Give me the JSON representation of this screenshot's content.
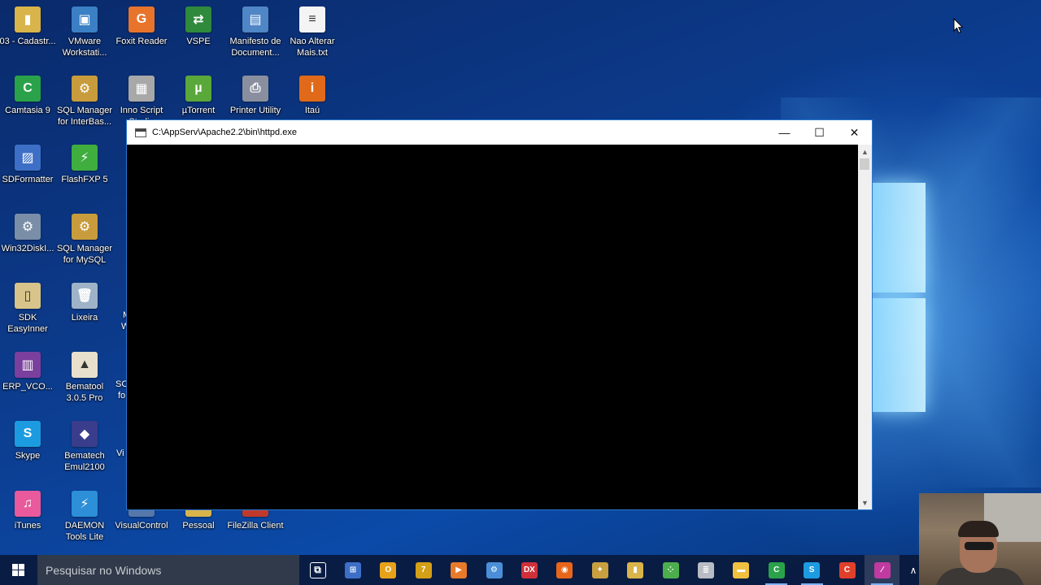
{
  "desktop": {
    "icons": [
      {
        "label": "03 - Cadastr...",
        "icon": "folder-file-icon",
        "color": "#d9b44a",
        "glyph": "▮"
      },
      {
        "label": "VMware Workstati...",
        "icon": "vmware-icon",
        "color": "#3b7fc4",
        "glyph": "▣"
      },
      {
        "label": "Foxit Reader",
        "icon": "foxit-reader-icon",
        "color": "#e8742c",
        "glyph": "G"
      },
      {
        "label": "VSPE",
        "icon": "vspe-icon",
        "color": "#2f8a3c",
        "glyph": "⇄"
      },
      {
        "label": "Manifesto de Document...",
        "icon": "manifesto-icon",
        "color": "#4f86c6",
        "glyph": "▤"
      },
      {
        "label": "Nao Alterar Mais.txt",
        "icon": "text-file-icon",
        "color": "#f4f4f4",
        "glyph": "≡"
      },
      {
        "label": "Camtasia 9",
        "icon": "camtasia-icon",
        "color": "#2aa24a",
        "glyph": "C"
      },
      {
        "label": "SQL Manager for InterBas...",
        "icon": "sql-manager-interbase-icon",
        "color": "#c89b3c",
        "glyph": "⚙"
      },
      {
        "label": "Inno Script Studio",
        "icon": "inno-script-icon",
        "color": "#a8a8a8",
        "glyph": "▦"
      },
      {
        "label": "µTorrent",
        "icon": "utorrent-icon",
        "color": "#5aa83a",
        "glyph": "µ"
      },
      {
        "label": "Printer Utility",
        "icon": "printer-utility-icon",
        "color": "#8a8fa0",
        "glyph": "⎙"
      },
      {
        "label": "Itaú",
        "icon": "itau-icon",
        "color": "#e06a1a",
        "glyph": "i"
      },
      {
        "label": "SDFormatter",
        "icon": "sdformatter-icon",
        "color": "#3d6fc7",
        "glyph": "▨"
      },
      {
        "label": "FlashFXP 5",
        "icon": "flashfxp-icon",
        "color": "#3fae3f",
        "glyph": "⚡"
      },
      {
        "label": "Win32DiskI...",
        "icon": "win32diskimager-icon",
        "color": "#7a8ea8",
        "glyph": "⚙"
      },
      {
        "label": "SQL Manager for MySQL",
        "icon": "sql-manager-mysql-icon",
        "color": "#c89b3c",
        "glyph": "⚙"
      },
      {
        "label": "SDK EasyInner",
        "icon": "sdk-easyinner-icon",
        "color": "#d8c48a",
        "glyph": "▯"
      },
      {
        "label": "Lixeira",
        "icon": "recycle-bin-icon",
        "color": "#9fb3c8",
        "glyph": "🗑"
      },
      {
        "label": "ERP_VCO...",
        "icon": "erp-archive-icon",
        "color": "#7b3f9e",
        "glyph": "▥"
      },
      {
        "label": "Bematool 3.0.5 Pro",
        "icon": "bematool-icon",
        "color": "#e8e0cc",
        "glyph": "▲"
      },
      {
        "label": "Skype",
        "icon": "skype-icon",
        "color": "#1d9be0",
        "glyph": "S"
      },
      {
        "label": "Bematech Emul2100",
        "icon": "bematech-icon",
        "color": "#3a3d8c",
        "glyph": "◆"
      },
      {
        "label": "iTunes",
        "icon": "itunes-icon",
        "color": "#e85a9c",
        "glyph": "♫"
      },
      {
        "label": "DAEMON Tools Lite",
        "icon": "daemon-tools-icon",
        "color": "#2d8fd8",
        "glyph": "⚡"
      },
      {
        "label": "VisualControl",
        "icon": "visualcontrol-icon",
        "color": "#5577aa",
        "glyph": "▣"
      },
      {
        "label": "Pessoal",
        "icon": "pessoal-folder-icon",
        "color": "#d9b44a",
        "glyph": "▮"
      },
      {
        "label": "FileZilla Client",
        "icon": "filezilla-icon",
        "color": "#c0392b",
        "glyph": "Z"
      }
    ],
    "partial_labels": [
      "M",
      "W",
      "SC",
      "fo",
      "Vi"
    ]
  },
  "console_window": {
    "title": "C:\\AppServ\\Apache2.2\\bin\\httpd.exe",
    "minimize_glyph": "—",
    "maximize_glyph": "☐",
    "close_glyph": "✕",
    "scroll_up_glyph": "▲",
    "scroll_down_glyph": "▼"
  },
  "taskbar": {
    "search_placeholder": "Pesquisar no Windows",
    "tray_chevron": "∧",
    "apps": [
      {
        "name": "task-view-icon",
        "glyph": "⧉",
        "color": "transparent"
      },
      {
        "name": "network-app-icon",
        "glyph": "⊞",
        "color": "#3d6fc7"
      },
      {
        "name": "outlook-icon",
        "glyph": "O",
        "color": "#e8a21a"
      },
      {
        "name": "seven-zip-icon",
        "glyph": "7",
        "color": "#d4a017"
      },
      {
        "name": "media-player-icon",
        "glyph": "▶",
        "color": "#e87a2a"
      },
      {
        "name": "settings-gear-icon",
        "glyph": "⚙",
        "color": "#4a8fd8"
      },
      {
        "name": "dx-icon",
        "glyph": "DX",
        "color": "#d0303a"
      },
      {
        "name": "firefox-icon",
        "glyph": "◉",
        "color": "#e8661a"
      },
      {
        "name": "explorer-tree-icon",
        "glyph": "✦",
        "color": "#c8a040"
      },
      {
        "name": "archive-app-icon",
        "glyph": "▮",
        "color": "#d9b44a"
      },
      {
        "name": "dots-app-icon",
        "glyph": "⁘",
        "color": "#4cae4c"
      },
      {
        "name": "database-icon",
        "glyph": "≣",
        "color": "#b8bcc4"
      },
      {
        "name": "file-explorer-icon",
        "glyph": "▬",
        "color": "#f0c040"
      },
      {
        "name": "camtasia-taskbar-icon",
        "glyph": "C",
        "color": "#2aa24a"
      },
      {
        "name": "skype-taskbar-icon",
        "glyph": "S",
        "color": "#1d9be0"
      },
      {
        "name": "red-app-icon",
        "glyph": "C",
        "color": "#e0402a"
      },
      {
        "name": "apache-feather-icon",
        "glyph": "∕",
        "color": "#c03aa0"
      }
    ]
  }
}
